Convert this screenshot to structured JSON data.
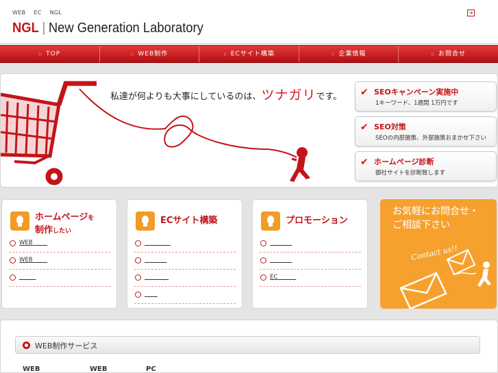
{
  "header": {
    "tagline": [
      "WEB",
      "EC",
      "NGL"
    ],
    "logo_mark": "NGL",
    "logo_sep": "|",
    "logo_name": "New Generation Laboratory",
    "exit_icon": "exit-icon"
  },
  "nav": {
    "dots": "::",
    "items": [
      "TOP",
      "WEB制作",
      "ECサイト構築",
      "企業情報",
      "お問合せ"
    ]
  },
  "hero": {
    "text_pre": "私達が何よりも大事にしているのは、",
    "text_big": "ツナガリ",
    "text_post": "です。"
  },
  "services": [
    {
      "title": "SEOキャンペーン実施中",
      "sub": "1キーワード、1週間 1万円です"
    },
    {
      "title": "SEO対策",
      "sub": "SEOの内部施策、外部施策おまかせ下さい"
    },
    {
      "title": "ホームページ診断",
      "sub": "御社サイトを診断致します"
    }
  ],
  "cards": [
    {
      "title1": "ホームページ",
      "title1_small": "を",
      "title2": "制作",
      "title2_small": "したい",
      "items": [
        "WEB",
        "WEB",
        ""
      ]
    },
    {
      "title1": "ECサイト構築",
      "title1_small": "",
      "title2": "",
      "title2_small": "",
      "items": [
        "",
        "",
        "",
        ""
      ]
    },
    {
      "title1": "プロモーション",
      "title1_small": "",
      "title2": "",
      "title2_small": "",
      "items": [
        "",
        "",
        "EC"
      ]
    }
  ],
  "contact": {
    "line1": "お気軽にお問合せ・",
    "line2": "ご相談下さい",
    "script": "Contact us!!"
  },
  "section": {
    "title": "WEB制作サービス",
    "cols": [
      "WEB",
      "WEB",
      "PC"
    ]
  },
  "colors": {
    "brand": "#c4141a",
    "orange": "#f6a12e"
  }
}
